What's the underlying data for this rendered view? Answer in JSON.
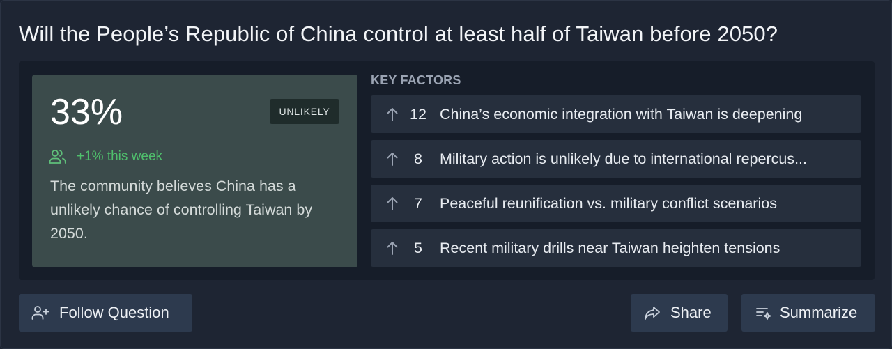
{
  "question": {
    "title": "Will the People’s Republic of China control at least half of Taiwan before 2050?"
  },
  "forecast": {
    "probability": "33%",
    "badge": "UNLIKELY",
    "trend": "+1% this week",
    "description": "The community believes China has a unlikely chance of controlling Taiwan by 2050."
  },
  "key_factors": {
    "heading": "KEY FACTORS",
    "items": [
      {
        "votes": "12",
        "text": "China’s economic integration with Taiwan is deepening",
        "icon": "arrow-up-icon"
      },
      {
        "votes": "8",
        "text": "Military action is unlikely due to international repercus...",
        "icon": "arrow-up-icon"
      },
      {
        "votes": "7",
        "text": "Peaceful reunification vs. military conflict scenarios",
        "icon": "arrow-up-icon"
      },
      {
        "votes": "5",
        "text": "Recent military drills near Taiwan heighten tensions",
        "icon": "arrow-up-icon"
      }
    ]
  },
  "actions": {
    "follow": "Follow Question",
    "share": "Share",
    "summarize": "Summarize"
  },
  "colors": {
    "background": "#1e2533",
    "panel": "#161d29",
    "forecast_card": "#3b4b4b",
    "trend_green": "#4fbf6c",
    "factor_row": "#262f3d",
    "button": "#2d3a4e"
  }
}
